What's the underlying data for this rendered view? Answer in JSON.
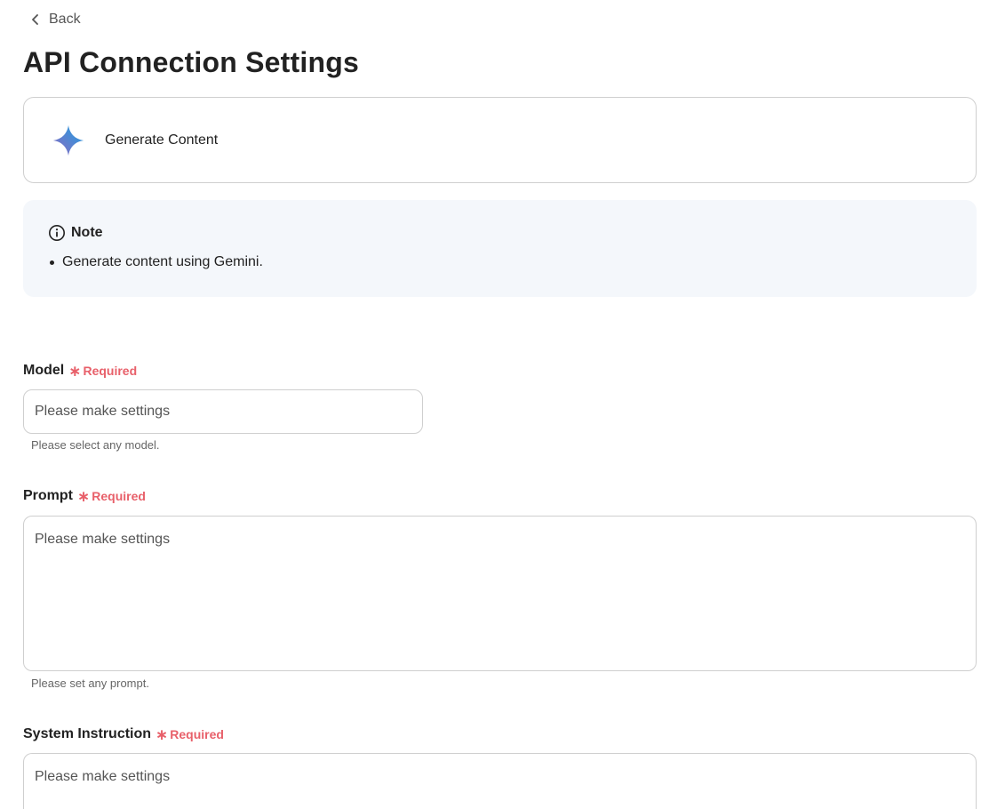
{
  "nav": {
    "back_label": "Back"
  },
  "page": {
    "title": "API Connection Settings"
  },
  "action": {
    "label": "Generate Content",
    "icon": "gemini-sparkle-icon"
  },
  "note": {
    "heading": "Note",
    "items": [
      "Generate content using Gemini."
    ]
  },
  "required_text": "Required",
  "fields": {
    "model": {
      "label": "Model",
      "placeholder": "Please make settings",
      "helper": "Please select any model."
    },
    "prompt": {
      "label": "Prompt",
      "placeholder": "Please make settings",
      "helper": "Please set any prompt."
    },
    "system_instruction": {
      "label": "System Instruction",
      "placeholder": "Please make settings"
    }
  },
  "colors": {
    "required": "#e8606a",
    "note_background": "#f4f7fb",
    "border": "#cfcfcf"
  }
}
